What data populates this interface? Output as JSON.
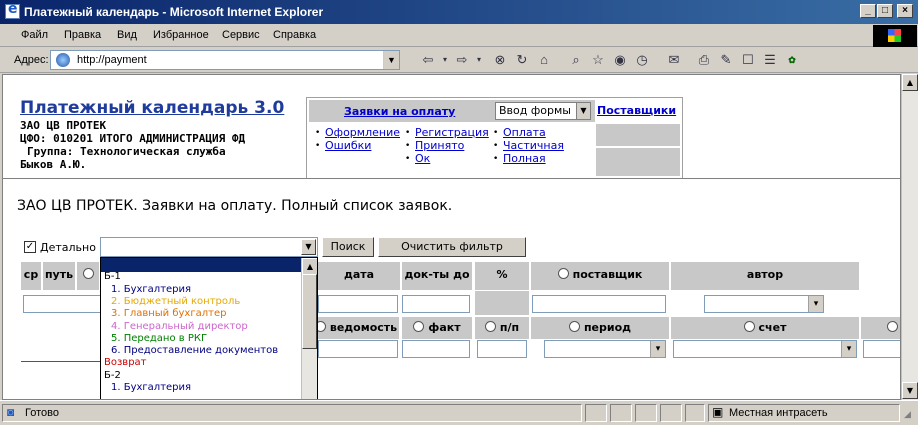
{
  "window": {
    "title": "Платежный календарь - Microsoft Internet Explorer"
  },
  "menu": [
    "Файл",
    "Правка",
    "Вид",
    "Избранное",
    "Сервис",
    "Справка"
  ],
  "address": {
    "label": "Адрес:",
    "url": "http://payment"
  },
  "toolbar_icons": [
    "back-icon",
    "forward-icon",
    "stop-icon",
    "refresh-icon",
    "home-icon",
    "search-icon",
    "favorites-icon",
    "media-icon",
    "history-icon",
    "mail-icon",
    "print-icon",
    "edit-icon",
    "discuss-icon",
    "messenger-icon",
    "pro-icon"
  ],
  "app": {
    "title": "Платежный календарь 3.0",
    "org": "ЗАО ЦВ ПРОТЕК",
    "cfo": "ЦФО: 010201 ИТОГО АДМИНИСТРАЦИЯ ФД",
    "group": "Группа: Технологическая служба",
    "user": "Быков А.Ю."
  },
  "nav": {
    "requests_link": "Заявки на оплату",
    "form_select": "Ввод формы",
    "suppliers_link": "Поставщики",
    "col1": [
      "Оформление",
      "Ошибки"
    ],
    "col2": [
      "Регистрация",
      "Принято",
      "Ок"
    ],
    "col3": [
      "Оплата",
      "Частичная",
      "Полная"
    ]
  },
  "page_heading": "ЗАО ЦВ ПРОТЕК. Заявки на оплату. Полный список заявок.",
  "filter": {
    "detail_label": "Детально",
    "detail_checked": "✓",
    "search_button": "Поиск",
    "clear_button": "Очистить фильтр"
  },
  "grid": {
    "row1_headers": [
      "ср",
      "путь",
      "дата",
      "док-ты до",
      "%",
      "поставщик",
      "автор"
    ],
    "row2_headers": [
      "ведомость",
      "факт",
      "п/п",
      "период",
      "счет"
    ]
  },
  "dropdown": {
    "items": [
      {
        "text": "",
        "color": "#ffffff"
      },
      {
        "text": "Б-1",
        "color": "#000000"
      },
      {
        "text": "1. Бухгалтерия",
        "color": "#000080"
      },
      {
        "text": "2. Бюджетный контроль",
        "color": "#e6a800"
      },
      {
        "text": "3. Главный бухгалтер",
        "color": "#e07000"
      },
      {
        "text": "4. Генеральный директор",
        "color": "#cc66cc"
      },
      {
        "text": "5. Передано в РКГ",
        "color": "#008000"
      },
      {
        "text": "6. Предоставление документов",
        "color": "#000080"
      },
      {
        "text": "Возврат",
        "color": "#cc0000"
      },
      {
        "text": "Б-2",
        "color": "#000000"
      },
      {
        "text": "1. Бухгалтерия",
        "color": "#000080"
      }
    ]
  },
  "status": {
    "text": "Готово",
    "zone": "Местная интрасеть"
  }
}
